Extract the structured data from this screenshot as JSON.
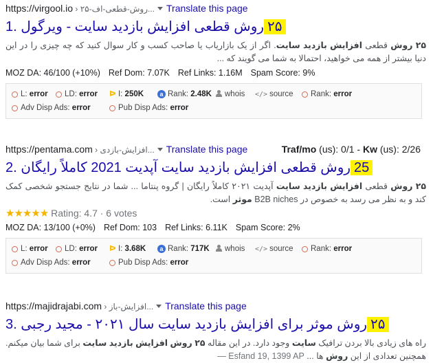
{
  "results": [
    {
      "url": "https://virgool.io",
      "crumb": " › ۲۵-روش-قطعی-اف...",
      "translate": "Translate this page",
      "num": "1.",
      "highlight": "۲۵",
      "title_rest": "روش قطعی افزایش بازدید سایت - ویرگول",
      "snippet_html": "<b>۲۵ روش</b> قطعی <b>افزایش بازدید سایت</b>. اگر از یک بازاریاب یا صاحب کسب و کار سوال کنید که چه چیزی را در این دنیا بیشتر از همه می خواهید، احتمالا به شما می گویند که ...",
      "moz": {
        "da": "MOZ DA: 46/100 (+10%)",
        "ref_dom": "Ref Dom: 7.07K",
        "ref_links": "Ref Links: 1.16M",
        "spam": "Spam Score: 9%"
      },
      "metrics": {
        "l": "error",
        "ld": "error",
        "i": "250K",
        "rank": "2.48K",
        "whois": "whois",
        "source": "source",
        "rank2": "error",
        "adv": "error",
        "pub": "error"
      }
    },
    {
      "url": "https://pentama.com",
      "crumb": " › افزایش-بازدی...",
      "translate": "Translate this page",
      "traf_label": "Traf/mo",
      "traf_value": " (us): 0/1 - ",
      "kw_label": "Kw",
      "kw_value": " (us): 2/26",
      "num": "2.",
      "highlight": "25",
      "title_rest": "روش قطعی افزایش بازدید سایت آپدیت 2021 کاملاً رایگان",
      "snippet_html": "<b>۲۵ روش</b> قطعی <b>افزایش بازدید سایت</b> آپدیت ۲۰۲۱ کاملاً رایگان | گروه پنتاما ... شما در نتایج جستجو شخصی کمک کند و به نظر می رسد به خصوص در B2B niches <b>موثر</b> است.",
      "rating_stars": "★★★★★",
      "rating": "Rating: 4.7 · 6 votes",
      "moz": {
        "da": "MOZ DA: 13/100 (+0%)",
        "ref_dom": "Ref Dom: 103",
        "ref_links": "Ref Links: 6.11K",
        "spam": "Spam Score: 2%"
      },
      "metrics": {
        "l": "error",
        "ld": "error",
        "i": "3.68K",
        "rank": "717K",
        "whois": "whois",
        "source": "source",
        "rank2": "error",
        "adv": "error",
        "pub": "error"
      }
    },
    {
      "url": "https://majidrajabi.com",
      "crumb": " › افزایش-باز...",
      "translate": "Translate this page",
      "num": "3.",
      "highlight": "۲۵",
      "title_rest": "روش موثر برای افزایش بازدید سایت سال ۲۰۲۱ - مجید رجبی",
      "snippet_date": "Esfand 19, 1399 AP — ",
      "snippet_html": "راه های زیادی بالا بردن ترافیک <b>سایت</b> وجود دارد. در این مقاله <b>۲۵ روش افزایش بازدید سایت</b> برای شما بیان میکنم. همچنین تعدادی از این <b>روش</b> ها ..."
    }
  ],
  "labels": {
    "l": "L: ",
    "ld": "LD: ",
    "i": "I: ",
    "rank": "Rank: ",
    "rank2": "Rank: ",
    "adv": "Adv Disp Ads: ",
    "pub": "Pub Disp Ads: "
  },
  "colors": {
    "link": "#1a0dab",
    "highlight": "#fff200",
    "error_circle": "#d9694c",
    "star": "#f4b400"
  }
}
